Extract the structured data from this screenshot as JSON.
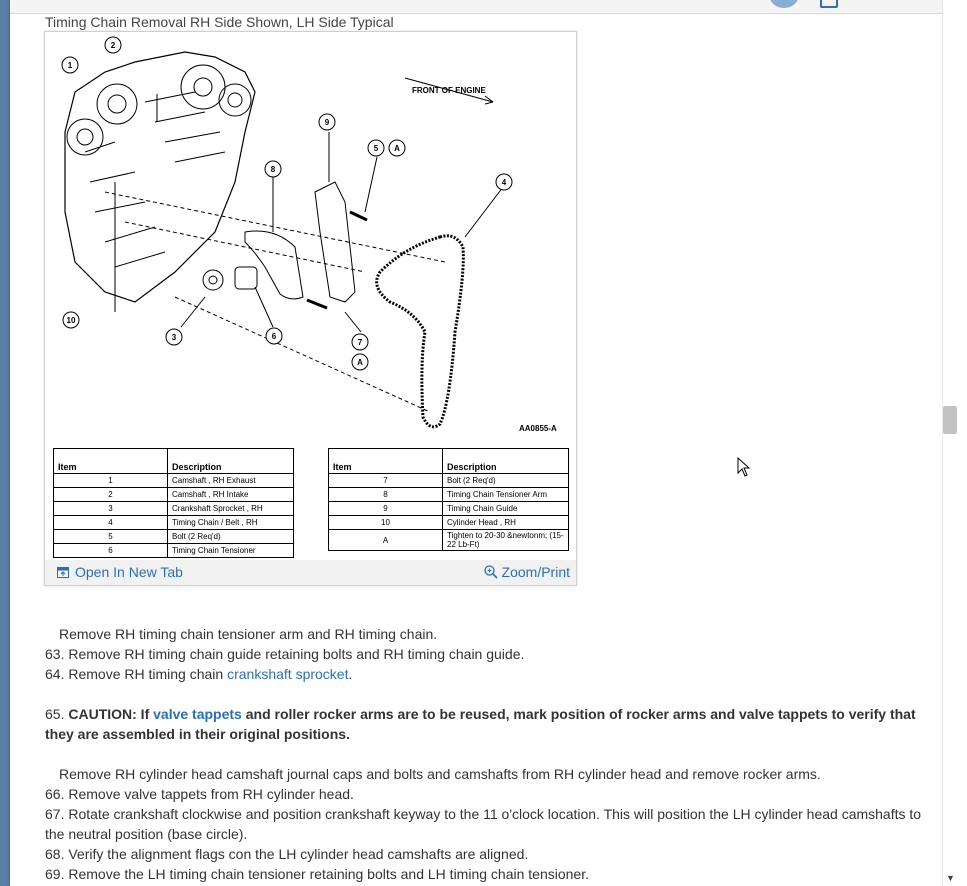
{
  "figure": {
    "title": "Timing Chain Removal RH Side Shown, LH Side Typical",
    "front_label": "FRONT OF ENGINE",
    "figure_code": "AA0855-A",
    "callouts": [
      "1",
      "2",
      "3",
      "4",
      "5",
      "6",
      "7",
      "8",
      "9",
      "10",
      "A",
      "A"
    ],
    "table_left": {
      "headers": [
        "Item",
        "Description"
      ],
      "rows": [
        {
          "item": "1",
          "desc": "Camshaft , RH Exhaust"
        },
        {
          "item": "2",
          "desc": "Camshaft , RH Intake"
        },
        {
          "item": "3",
          "desc": "Crankshaft Sprocket , RH"
        },
        {
          "item": "4",
          "desc": "Timing Chain / Belt , RH"
        },
        {
          "item": "5",
          "desc": "Bolt (2 Req'd)"
        },
        {
          "item": "6",
          "desc": "Timing Chain Tensioner"
        }
      ]
    },
    "table_right": {
      "headers": [
        "Item",
        "Description"
      ],
      "rows": [
        {
          "item": "7",
          "desc": "Bolt (2 Req'd)"
        },
        {
          "item": "8",
          "desc": "Timing Chain Tensioner Arm"
        },
        {
          "item": "9",
          "desc": "Timing Chain Guide"
        },
        {
          "item": "10",
          "desc": "Cylinder Head , RH"
        },
        {
          "item": "A",
          "desc": "Tighten to 20-30 &newtonm; (15-22 Lb-Ft)"
        }
      ]
    },
    "open_tab_label": "Open In New Tab",
    "zoom_label": "Zoom/Print"
  },
  "steps": {
    "s62": "Remove RH timing chain tensioner arm and RH timing chain.",
    "s63_num": "63.",
    "s63": "Remove RH timing chain guide retaining bolts and RH timing chain guide.",
    "s64_num": "64.",
    "s64_pre": "Remove RH timing chain ",
    "s64_link": "crankshaft sprocket",
    "s64_post": ".",
    "s65_num": "65.",
    "s65_caution": "CAUTION: If ",
    "s65_link": "valve tappets",
    "s65_rest": " and roller rocker arms are to be reused, mark position of rocker arms and valve tappets to verify that they are assembled in their original positions.",
    "s65b": "Remove RH cylinder head camshaft journal caps and bolts and camshafts from RH cylinder head and remove rocker arms.",
    "s66_num": "66.",
    "s66": "Remove valve tappets from RH cylinder head.",
    "s67_num": "67.",
    "s67": "Rotate crankshaft clockwise and position crankshaft keyway to the 11 o'clock location. This will position the LH cylinder head camshafts to the neutral position (base circle).",
    "s68_num": "68.",
    "s68": "Verify the alignment flags con the LH cylinder head camshafts are aligned.",
    "s69_num": "69.",
    "s69": "Remove the LH timing chain tensioner retaining bolts and LH timing chain tensioner."
  },
  "colors": {
    "link": "#2a6fb5",
    "page_bg": "#ffffff",
    "desktop": "#6f8fb0"
  }
}
